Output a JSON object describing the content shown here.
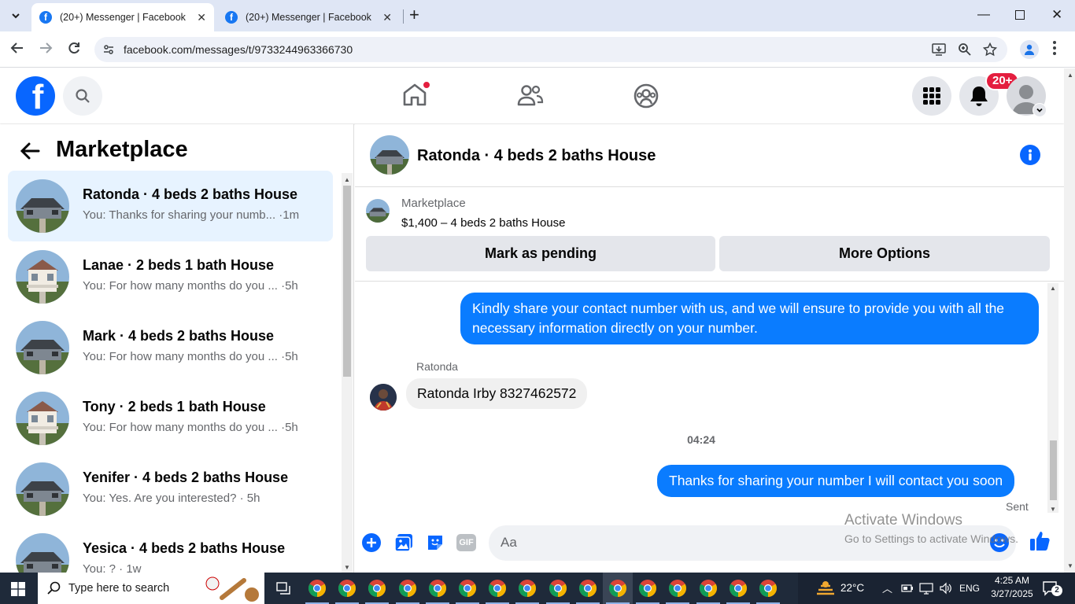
{
  "browser": {
    "tabs": [
      {
        "title": "(20+) Messenger | Facebook",
        "active": true
      },
      {
        "title": "(20+) Messenger | Facebook",
        "active": false
      }
    ],
    "url": "facebook.com/messages/t/9733244963366730"
  },
  "header": {
    "notification_badge": "20+"
  },
  "sidebar": {
    "title": "Marketplace",
    "conversations": [
      {
        "title": "Ratonda · 4 beds 2 baths House",
        "preview": "You: Thanks for sharing your numb... ·1m",
        "selected": true,
        "house": "gray"
      },
      {
        "title": "Lanae · 2 beds 1 bath House",
        "preview": "You: For how many months do you ... ·5h",
        "selected": false,
        "house": "white"
      },
      {
        "title": "Mark · 4 beds 2 baths House",
        "preview": "You: For how many months do you ... ·5h",
        "selected": false,
        "house": "gray"
      },
      {
        "title": "Tony · 2 beds 1 bath House",
        "preview": "You: For how many months do you ... ·5h",
        "selected": false,
        "house": "white"
      },
      {
        "title": "Yenifer · 4 beds 2 baths House",
        "preview": "You: Yes. Are you interested? · 5h",
        "selected": false,
        "house": "gray"
      },
      {
        "title": "Yesica · 4 beds 2 baths House",
        "preview": "You: ? · 1w",
        "selected": false,
        "house": "gray"
      }
    ]
  },
  "chat": {
    "title": "Ratonda · 4 beds 2 baths House",
    "listing": {
      "source": "Marketplace",
      "detail": "$1,400 – 4 beds 2 baths House"
    },
    "buttons": {
      "pending": "Mark as pending",
      "more": "More Options"
    },
    "messages": {
      "outgoing_1": "Kindly share your contact number with us, and we will ensure to provide you with all the necessary information directly on your number.",
      "sender_name": "Ratonda",
      "incoming_1": "Ratonda Irby 8327462572",
      "timestamp": "04:24",
      "outgoing_2": "Thanks for sharing your number I will contact you soon",
      "status": "Sent"
    },
    "composer_placeholder": "Aa"
  },
  "watermark": {
    "line1": "Activate Windows",
    "line2": "Go to Settings to activate Windows."
  },
  "taskbar": {
    "search_placeholder": "Type here to search",
    "weather": "22°C",
    "language": "ENG",
    "time": "4:25 AM",
    "date": "3/27/2025",
    "notifications": "2"
  }
}
